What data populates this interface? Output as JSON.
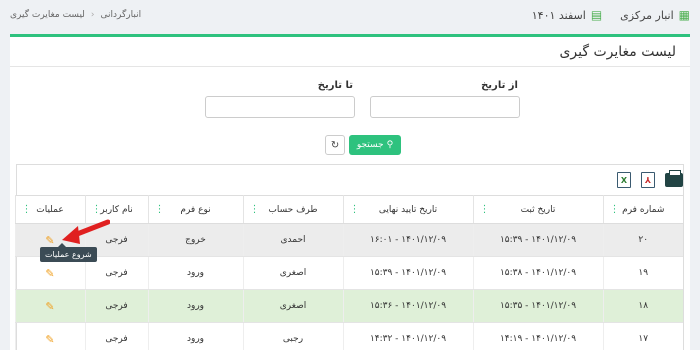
{
  "header": {
    "warehouse": "انبار مرکزی",
    "period": "اسفند ۱۴۰۱",
    "breadcrumb": [
      "انبارگردانی",
      "لیست مغایرت گیری"
    ]
  },
  "page": {
    "title": "لیست مغایرت گیری"
  },
  "filters": {
    "from_label": "از تاریخ",
    "to_label": "تا تاریخ",
    "from_value": "",
    "to_value": ""
  },
  "actions": {
    "search_label": "جستجو"
  },
  "table": {
    "columns": [
      "شماره فرم",
      "تاریخ ثبت",
      "تاریخ تایید نهایی",
      "طرف حساب",
      "نوع فرم",
      "نام کاربر",
      "عملیات"
    ],
    "rows": [
      [
        "۲۰",
        "۱۴۰۱/۱۲/۰۹ - ۱۵:۳۹",
        "۱۴۰۱/۱۲/۰۹ - ۱۶:۰۱",
        "احمدی",
        "خروج",
        "فرجی",
        ""
      ],
      [
        "۱۹",
        "۱۴۰۱/۱۲/۰۹ - ۱۵:۳۸",
        "۱۴۰۱/۱۲/۰۹ - ۱۵:۳۹",
        "اصغری",
        "ورود",
        "فرجی",
        ""
      ],
      [
        "۱۸",
        "۱۴۰۱/۱۲/۰۹ - ۱۵:۳۵",
        "۱۴۰۱/۱۲/۰۹ - ۱۵:۳۶",
        "اصغری",
        "ورود",
        "فرجی",
        ""
      ],
      [
        "۱۷",
        "۱۴۰۱/۱۲/۰۹ - ۱۴:۱۹",
        "۱۴۰۱/۱۲/۰۹ - ۱۴:۳۲",
        "رجبی",
        "ورود",
        "فرجی",
        ""
      ]
    ]
  },
  "tooltip": {
    "text": "شروع عملیات"
  },
  "colors": {
    "accent": "#2ec27e",
    "selected_row": "#dff0d8",
    "arrow": "#e02020"
  },
  "icons": [
    "warehouse-icon",
    "calendar-icon",
    "search-icon",
    "refresh-icon",
    "print-icon",
    "pdf-icon",
    "excel-icon",
    "pencil-icon",
    "column-menu-icon"
  ]
}
